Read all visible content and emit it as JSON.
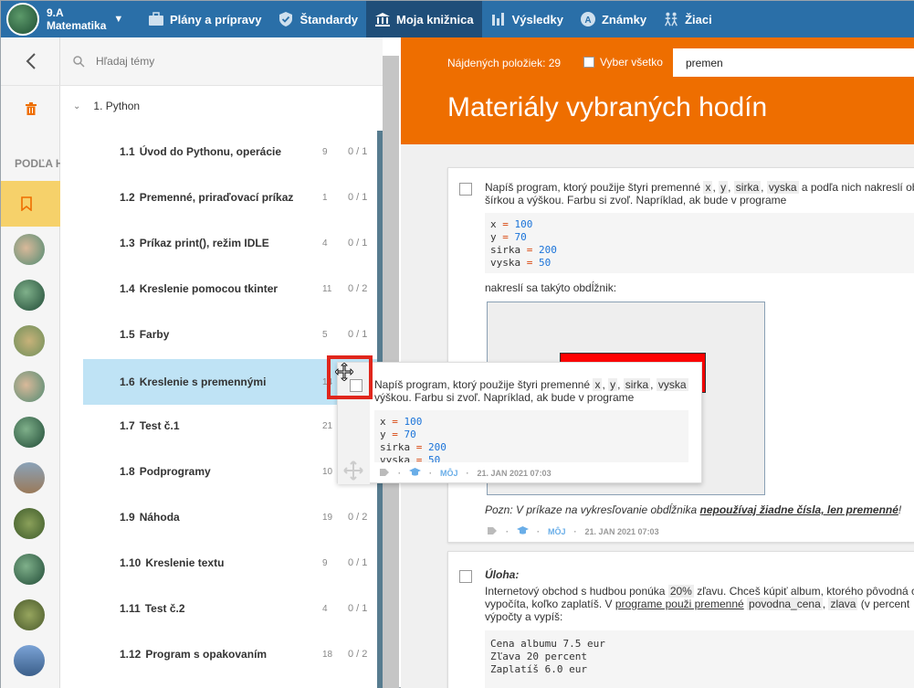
{
  "header": {
    "class_name": "9.A",
    "subject": "Matematika",
    "nav": [
      {
        "label": "Plány a prípravy",
        "icon": "briefcase-icon",
        "active": false
      },
      {
        "label": "Štandardy",
        "icon": "shield-check-icon",
        "active": false
      },
      {
        "label": "Moja knižnica",
        "icon": "library-icon",
        "active": true
      },
      {
        "label": "Výsledky",
        "icon": "bar-chart-icon",
        "active": false
      },
      {
        "label": "Známky",
        "icon": "grade-icon",
        "active": false
      },
      {
        "label": "Žiaci",
        "icon": "students-icon",
        "active": false
      }
    ]
  },
  "topics": {
    "search_placeholder": "Hľadaj témy",
    "section": "1. Python",
    "podla_label": "PODĽA H",
    "items": [
      {
        "num": "1.1",
        "title": "Úvod do Pythonu, operácie",
        "count": "9",
        "progress": "0 / 1"
      },
      {
        "num": "1.2",
        "title": "Premenné, priraďovací príkaz",
        "count": "1",
        "progress": "0 / 1"
      },
      {
        "num": "1.3",
        "title": "Príkaz print(), režim IDLE",
        "count": "4",
        "progress": "0 / 1"
      },
      {
        "num": "1.4",
        "title": "Kreslenie pomocou tkinter",
        "count": "11",
        "progress": "0 / 2"
      },
      {
        "num": "1.5",
        "title": "Farby",
        "count": "5",
        "progress": "0 / 1"
      },
      {
        "num": "1.6",
        "title": "Kreslenie s premennými",
        "count": "14",
        "progress": ""
      },
      {
        "num": "1.7",
        "title": "Test č.1",
        "count": "21",
        "progress": ""
      },
      {
        "num": "1.8",
        "title": "Podprogramy",
        "count": "10",
        "progress": ""
      },
      {
        "num": "1.9",
        "title": "Náhoda",
        "count": "19",
        "progress": "0 / 2"
      },
      {
        "num": "1.10",
        "title": "Kreslenie textu",
        "count": "9",
        "progress": "0 / 1"
      },
      {
        "num": "1.11",
        "title": "Test č.2",
        "count": "4",
        "progress": "0 / 1"
      },
      {
        "num": "1.12",
        "title": "Program s opakovaním",
        "count": "18",
        "progress": "0 / 2"
      }
    ]
  },
  "main": {
    "found_label": "Nájdených položiek: 29",
    "select_all": "Vyber všetko",
    "search_value": "premen",
    "title": "Materiály vybraných hodín",
    "card1": {
      "text_a": "Napíš program, ktorý použije štyri premenné",
      "var_x": "x",
      "var_y": "y",
      "var_sirka": "sirka",
      "var_vyska": "vyska",
      "text_b": "a podľa nich nakreslí ob",
      "text_c": "šírkou a výškou. Farbu si zvoľ. Napríklad, ak bude v programe",
      "code": [
        {
          "name": "x",
          "value": "100"
        },
        {
          "name": "y",
          "value": "70"
        },
        {
          "name": "sirka",
          "value": "200"
        },
        {
          "name": "vyska",
          "value": "50"
        }
      ],
      "after_code": "nakreslí sa takýto obdĺžnik:",
      "note_a": "Pozn: V príkaze na vykresľovanie obdĺžnika ",
      "note_b": "nepoužívaj žiadne čísla, len premenné",
      "note_c": "!",
      "owner": "MÔJ",
      "date": "21. JAN 2021 07:03"
    },
    "card2": {
      "heading": "Úloha:",
      "text_a": "Internetový obchod s hudbou ponúka",
      "discount": "20%",
      "text_b": "zľavu. Chceš kúpiť album, ktorého pôvodná c",
      "text_c": "vypočíta, koľko zaplatíš. V",
      "text_link": "programe použi premenné",
      "var1": "povodna_cena",
      "var2": "zlava",
      "text_d": "(v percent",
      "text_e": "výpočty a vypíš:",
      "code": "Cena albumu 7.5 eur\nZľava 20 percent\nZaplatíš 6.0 eur"
    }
  },
  "drag_preview": {
    "text_a": "Napíš program, ktorý použije štyri premenné",
    "var_x": "x",
    "var_y": "y",
    "var_sirka": "sirka",
    "var_vyska": "vyska",
    "text_b": "výškou. Farbu si zvoľ. Napríklad, ak bude v programe",
    "code": [
      {
        "name": "x",
        "value": "100"
      },
      {
        "name": "y",
        "value": "70"
      },
      {
        "name": "sirka",
        "value": "200"
      },
      {
        "name": "vyska",
        "value": "50"
      }
    ],
    "owner": "MÔJ",
    "date": "21. JAN 2021 07:03"
  },
  "colors": {
    "nav_bg": "#2a6fa8",
    "nav_active": "#1f4e79",
    "header_orange": "#ee6e00",
    "selected_row": "#bfe3f5",
    "highlight_red": "#e0261c"
  }
}
